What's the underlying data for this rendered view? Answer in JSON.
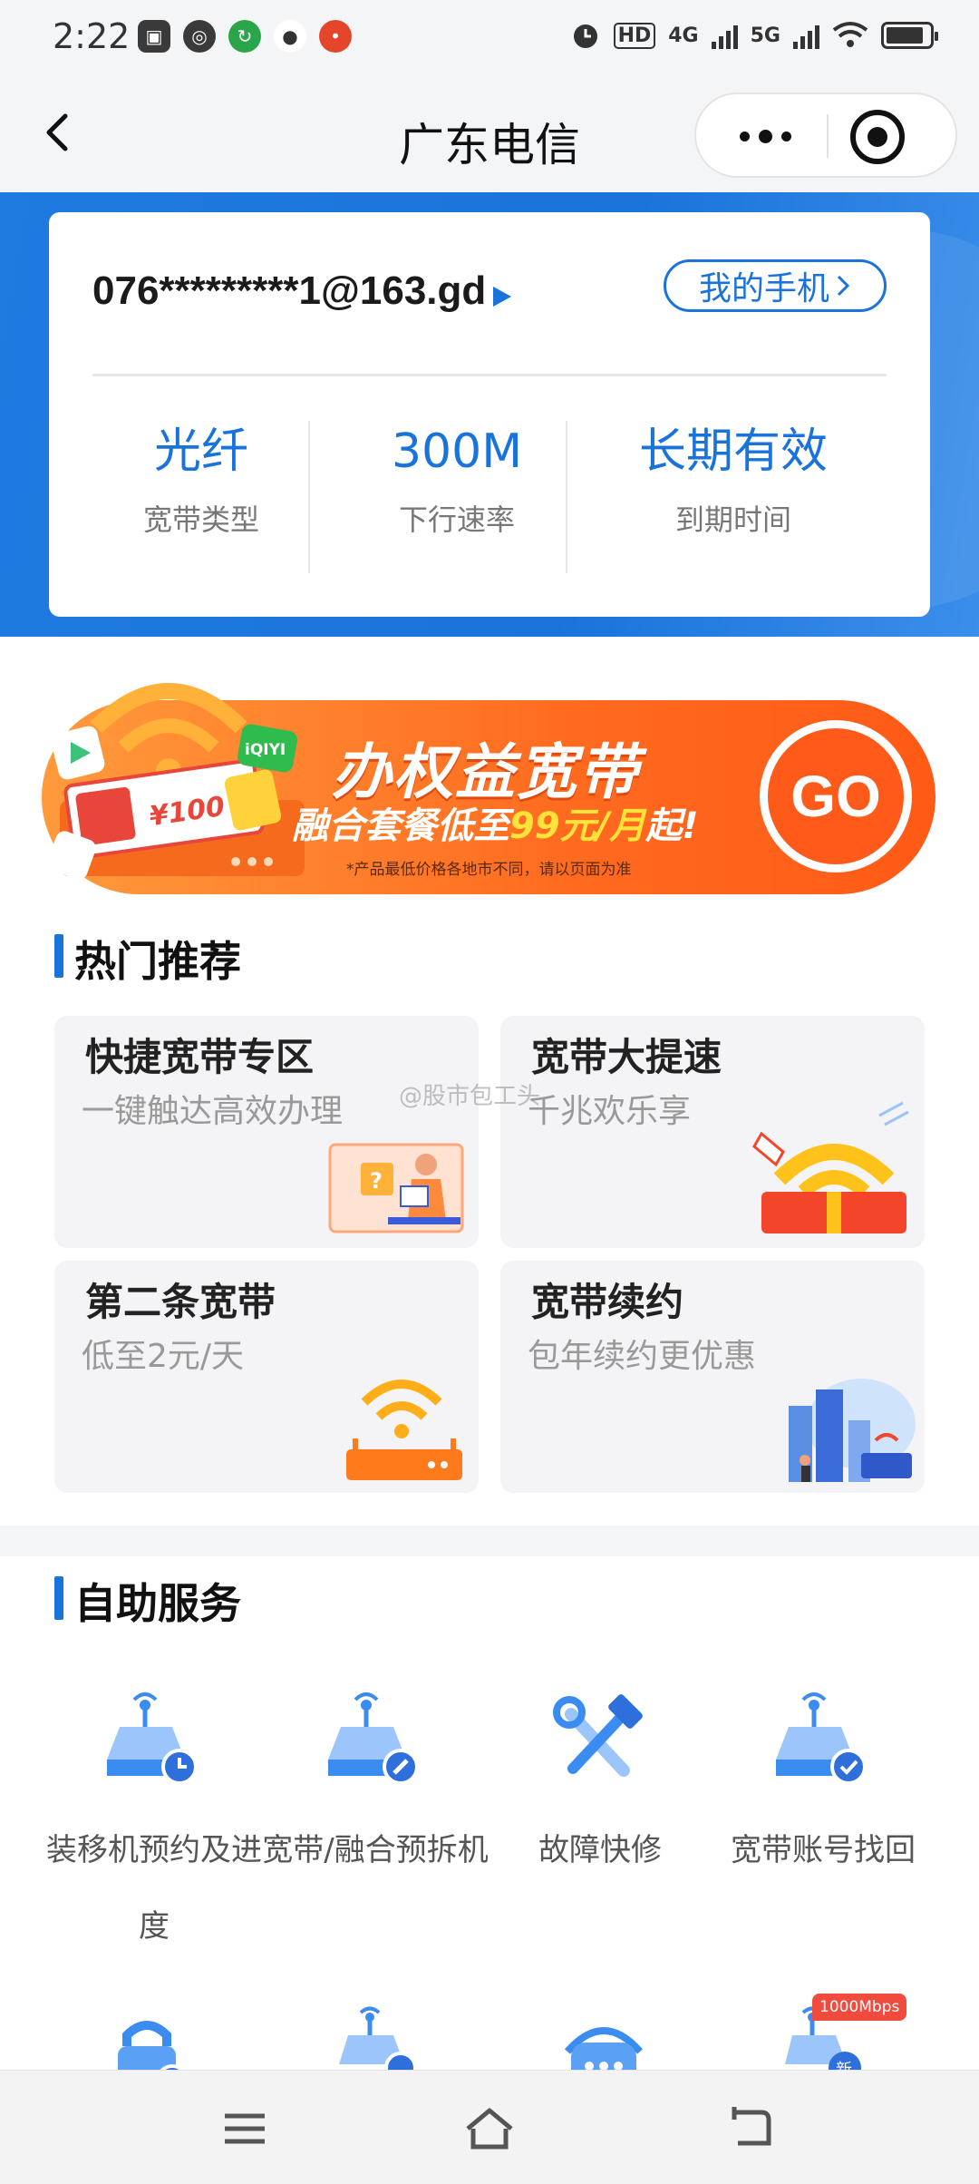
{
  "status_bar": {
    "time": "2:22",
    "hd": "HD",
    "net1": "4G",
    "net2": "5G"
  },
  "nav": {
    "title": "广东电信"
  },
  "account": {
    "id": "076*********1@163.gd",
    "my_phone": "我的手机",
    "stats": [
      {
        "value": "光纤",
        "label": "宽带类型"
      },
      {
        "value": "300M",
        "label": "下行速率"
      },
      {
        "value": "长期有效",
        "label": "到期时间"
      }
    ]
  },
  "promo": {
    "title": "办权益宽带",
    "subtitle_prefix": "融合套餐低至",
    "subtitle_highlight": "99元/月",
    "subtitle_suffix": "起!",
    "note": "*产品最低价格各地市不同，请以页面为准",
    "go": "GO",
    "voucher": "¥100",
    "brand": "iQIYI"
  },
  "hot": {
    "title": "热门推荐",
    "tiles": [
      {
        "title": "快捷宽带专区",
        "subtitle": "一键触达高效办理"
      },
      {
        "title": "宽带大提速",
        "subtitle": "千兆欢乐享"
      },
      {
        "title": "第二条宽带",
        "subtitle": "低至2元/天"
      },
      {
        "title": "宽带续约",
        "subtitle": "包年续约更优惠"
      }
    ]
  },
  "watermark": "@股市包工头",
  "self_service": {
    "title": "自助服务",
    "items": [
      {
        "label": "装移机预约及进度"
      },
      {
        "label": "宽带/融合预拆机"
      },
      {
        "label": "故障快修"
      },
      {
        "label": "宽带账号找回"
      }
    ],
    "badge": "1000Mbps",
    "new_tag": "新"
  },
  "colors": {
    "brand_blue": "#1a73db",
    "promo_orange": "#ff6a1f"
  }
}
